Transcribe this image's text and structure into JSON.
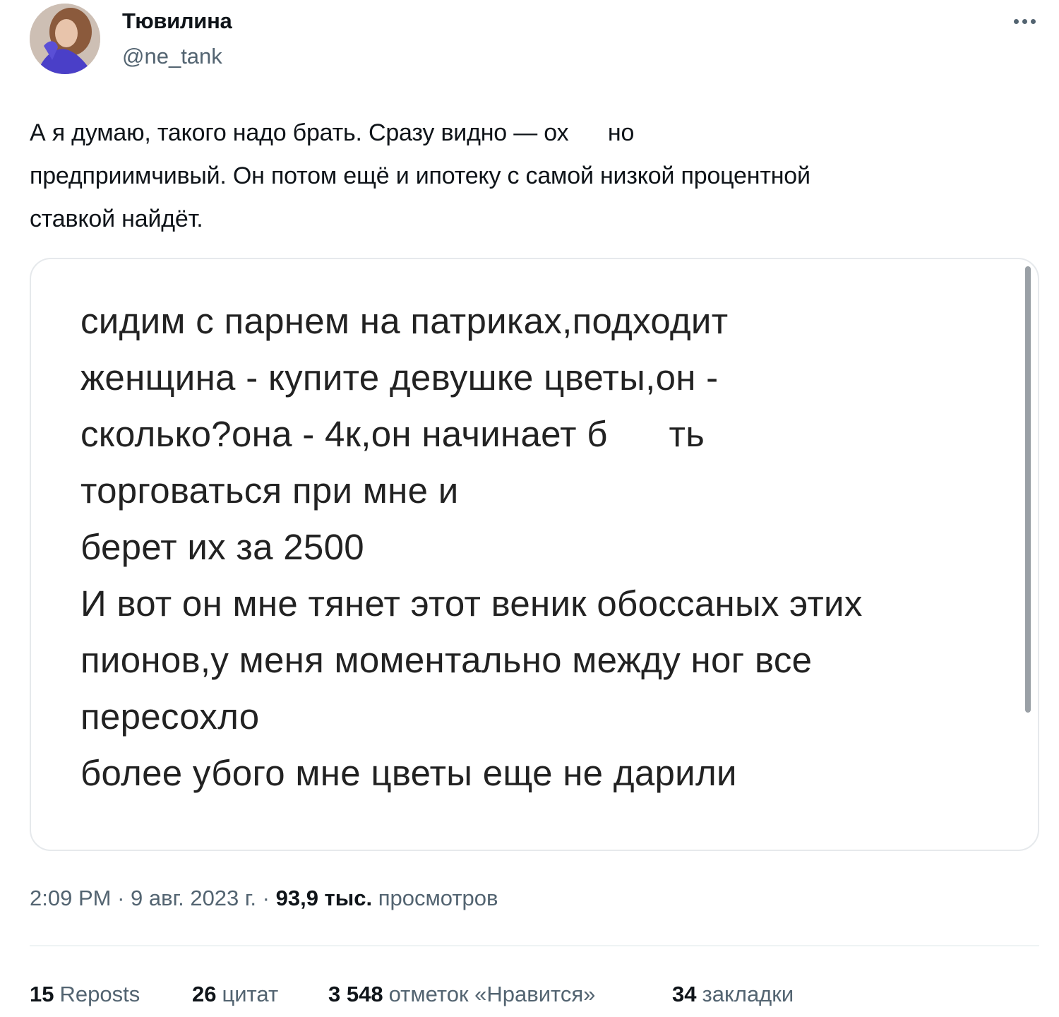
{
  "author": {
    "name": "Тювилина",
    "handle": "@ne_tank"
  },
  "tweet": {
    "lines": [
      "А я думаю, такого надо брать. Сразу видно — ох      но",
      "предприимчивый. Он потом ещё и ипотеку с самой низкой процентной",
      "ставкой найдёт."
    ]
  },
  "media": {
    "lines": [
      "сидим с парнем на патриках,подходит",
      "женщина - купите девушке цветы,он -",
      "сколько?она - 4к,он начинает б      ть",
      "торговаться при мне и",
      "берет их за 2500",
      "И вот он мне тянет этот веник обоссаных этих",
      "пионов,у меня моментально между ног все",
      "пересохло",
      "более убого мне цветы еще не дарили"
    ]
  },
  "meta": {
    "time": "2:09 PM",
    "separator": " · ",
    "date": "9 авг. 2023 г.",
    "views_count": "93,9 тыс.",
    "views_label": "просмотров"
  },
  "stats": {
    "reposts": {
      "count": "15",
      "label": "Reposts"
    },
    "quotes": {
      "count": "26",
      "label": "цитат"
    },
    "likes": {
      "count": "3 548",
      "label": "отметок «Нравится»"
    },
    "bookmarks": {
      "count": "34",
      "label": "закладки"
    }
  },
  "icons": {
    "more": "more-horizontal-icon"
  },
  "colors": {
    "text_primary": "#0f1419",
    "text_secondary": "#536471",
    "border": "#e6e9ec"
  }
}
